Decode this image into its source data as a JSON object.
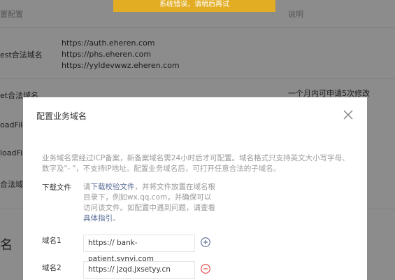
{
  "background": {
    "header_left": "置配置",
    "header_right": "说明",
    "rows": [
      {
        "label": "est合法域名"
      },
      {
        "label": "et合法域名"
      },
      {
        "label": "oadFile合"
      },
      {
        "label": "loadFi"
      },
      {
        "label": "合法域名"
      }
    ],
    "domains": [
      "https://auth.eheren.com",
      "https://phs.eheren.com",
      "https://yyldevwwz.eheren.com"
    ],
    "note": "一个月内可申请5次修改",
    "section_title": "名"
  },
  "toast": {
    "text": "系统错误，请稍后再试"
  },
  "modal": {
    "title": "配置业务域名",
    "description": "业务域名需经过ICP备案，新备案域名需24小时后才可配置。域名格式只支持英文大小写字母、数字及\"- \"，不支持IP地址。配置业务域名后，可打开任意合法的子域名。",
    "download": {
      "label": "下载文件",
      "text_before": "请",
      "link_text": "下载校验文件",
      "text_middle": "，并将文件放置在域名根目录下，例如wx.qq.com，并确保可以访问该文件。如配置中遇到问题，请查看",
      "help_link": "具体指引",
      "text_after": "。"
    },
    "domain1": {
      "label": "域名1",
      "value": "https://  bank-patient.synyi.com"
    },
    "domain2": {
      "label": "域名2",
      "value": "https://  jzqd.jxsetyy.cn"
    },
    "colors": {
      "add": "#576b95",
      "remove": "#e64340"
    }
  }
}
